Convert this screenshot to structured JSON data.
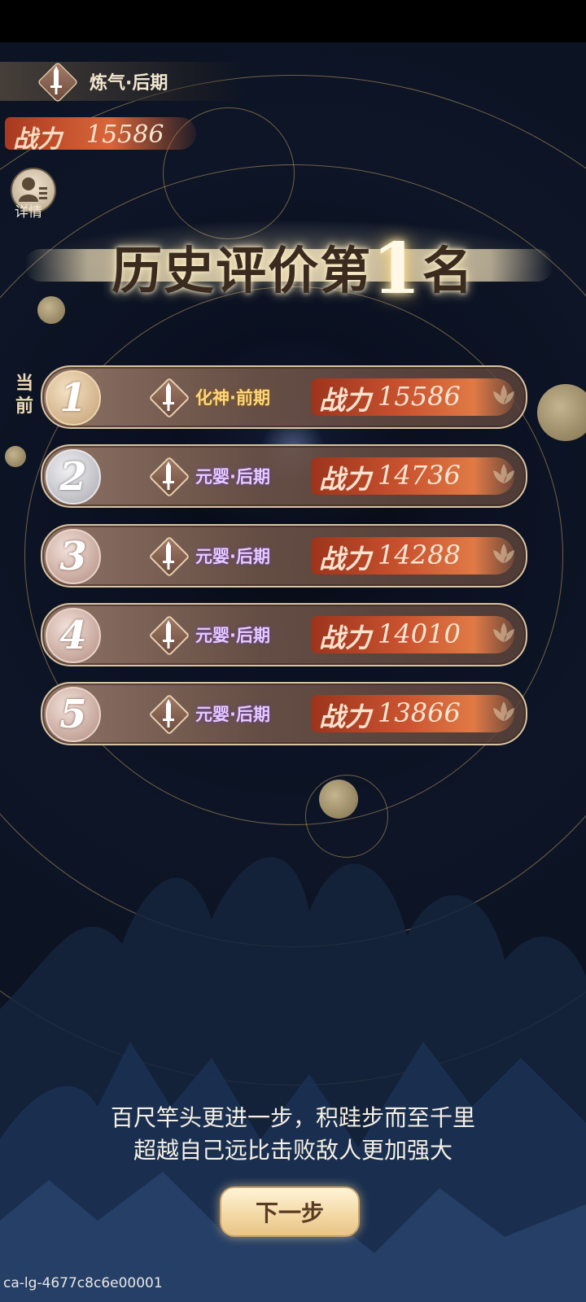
{
  "header": {
    "realm": "炼气·后期",
    "power_label": "战力",
    "power_value": "15586",
    "detail_label": "详情"
  },
  "title": {
    "prefix": "历史评价第",
    "rank": "1",
    "suffix": "名"
  },
  "current_marker": "当前",
  "ranking": [
    {
      "rank": "1",
      "realm": "化神·前期",
      "power_label": "战力",
      "power": "15586"
    },
    {
      "rank": "2",
      "realm": "元婴·后期",
      "power_label": "战力",
      "power": "14736"
    },
    {
      "rank": "3",
      "realm": "元婴·后期",
      "power_label": "战力",
      "power": "14288"
    },
    {
      "rank": "4",
      "realm": "元婴·后期",
      "power_label": "战力",
      "power": "14010"
    },
    {
      "rank": "5",
      "realm": "元婴·后期",
      "power_label": "战力",
      "power": "13866"
    }
  ],
  "quotes": [
    "百尺竿头更进一步，积跬步而至千里",
    "超越自己远比击败敌人更加强大"
  ],
  "next_button": "下一步",
  "watermark": "ca-lg-4677c8c6e00001",
  "colors": {
    "flame": "#c9522f",
    "realm_current": "#ffd77a",
    "realm_other": "#e6ccff",
    "gold_line": "#c4a062"
  },
  "icons": [
    "sword-icon",
    "profile-icon",
    "lotus-icon"
  ]
}
